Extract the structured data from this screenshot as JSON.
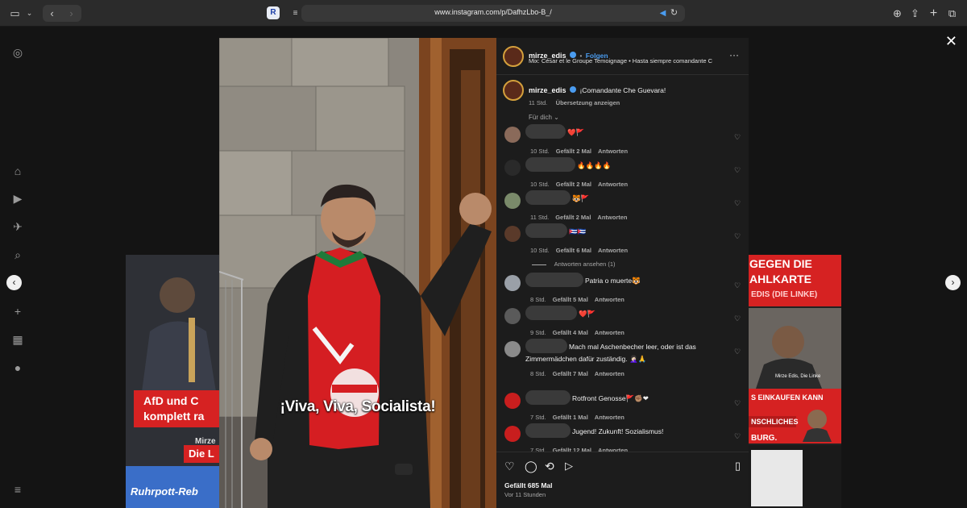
{
  "browser": {
    "url": "www.instagram.com/p/DafhzLbo-B_/",
    "extension_letter": "R"
  },
  "post": {
    "username": "mirze_edis",
    "follow_label": "Folgen",
    "audio": "Mix: César et le Groupe Temoignage • Hasta siempre comandante C",
    "more_icon": "more-dots-icon",
    "caption_user": "mirze_edis",
    "caption_text": "¡Comandante Che Guevara!",
    "caption_time": "11 Std.",
    "caption_translate": "Übersetzung anzeigen",
    "filter_label": "Für dich",
    "video_caption": "¡Viva, Viva, Socialista!",
    "likes": "Gefällt 685 Mal",
    "posted": "Vor 11 Stunden"
  },
  "comments": [
    {
      "text": "❤️🚩",
      "time": "10 Std.",
      "likes": "Gefällt 2 Mal",
      "reply": "Antworten",
      "avatar_color": "#8a6a5a"
    },
    {
      "text": "🔥🔥🔥🔥",
      "time": "10 Std.",
      "likes": "Gefällt 2 Mal",
      "reply": "Antworten",
      "avatar_color": "#2a2a2a"
    },
    {
      "text": "🐯🚩",
      "time": "11 Std.",
      "likes": "Gefällt 2 Mal",
      "reply": "Antworten",
      "avatar_color": "#7a8a6a"
    },
    {
      "text": "🇨🇺🇨🇺",
      "time": "10 Std.",
      "likes": "Gefällt 6 Mal",
      "reply": "Antworten",
      "avatar_color": "#5a3a2a"
    },
    {
      "text": "Patria o muerte🐯",
      "time": "8 Std.",
      "likes": "Gefällt 5 Mal",
      "reply": "Antworten",
      "avatar_color": "#9aa0a8"
    },
    {
      "text": "❤️🚩",
      "time": "9 Std.",
      "likes": "Gefällt 4 Mal",
      "reply": "Antworten",
      "avatar_color": "#5a5a5a"
    },
    {
      "text": "Mach mal Aschenbecher leer, oder ist das Zimmermädchen dafür zuständig. 🤦🏻‍♀️🙏",
      "time": "8 Std.",
      "likes": "Gefällt 7 Mal",
      "reply": "Antworten",
      "avatar_color": "#8a8a8a"
    },
    {
      "text": "Rotfront Genosse🚩✊🏽❤",
      "time": "7 Std.",
      "likes": "Gefällt 1 Mal",
      "reply": "Antworten",
      "avatar_color": "#c81e1e"
    },
    {
      "text": "Jugend! Zukunft! Sozialismus!",
      "time": "7 Std.",
      "likes": "Gefällt 12 Mal",
      "reply": "Antworten",
      "avatar_color": "#c81e1e"
    }
  ],
  "replies_label": "Antworten ansehen (1)",
  "tiles": {
    "left_band": "AfD und C komplett ra",
    "left_name": "Mirze",
    "left_tag": "Die L",
    "left_bottom": "Ruhrpott-Reb",
    "right_top": "GEGEN DIE AHLKARTE",
    "right_sub": "EDIS (DIE LINKE)",
    "right_label": "Mirze Edis, Die Linke",
    "right_mid": "S EINKAUFEN KANN",
    "right_mid2": "NSCHLICHES",
    "right_bottom": "BURG."
  },
  "colors": {
    "accent_blue": "#4a9cf0",
    "panel_bg": "#1c1c1c",
    "red": "#d62222"
  }
}
